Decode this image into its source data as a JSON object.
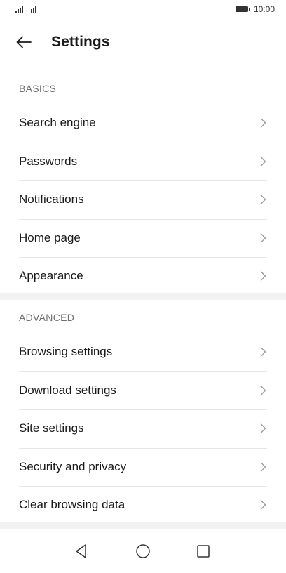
{
  "status_bar": {
    "time": "10:00"
  },
  "header": {
    "title": "Settings",
    "back_icon": "arrow-left-icon"
  },
  "sections": [
    {
      "title": "BASICS",
      "items": [
        {
          "label": "Search engine"
        },
        {
          "label": "Passwords"
        },
        {
          "label": "Notifications"
        },
        {
          "label": "Home page"
        },
        {
          "label": "Appearance"
        }
      ]
    },
    {
      "title": "ADVANCED",
      "items": [
        {
          "label": "Browsing settings"
        },
        {
          "label": "Download settings"
        },
        {
          "label": "Site settings"
        },
        {
          "label": "Security and privacy"
        },
        {
          "label": "Clear browsing data"
        }
      ]
    }
  ],
  "nav_bar": {
    "back_icon": "triangle-back-icon",
    "home_icon": "circle-home-icon",
    "recent_icon": "square-recents-icon"
  },
  "colors": {
    "text": "#1a1a1a",
    "section_header": "#6e6e6e",
    "separator": "#e6e6e6",
    "band": "#f2f2f2",
    "chevron": "#9a9a9a"
  }
}
